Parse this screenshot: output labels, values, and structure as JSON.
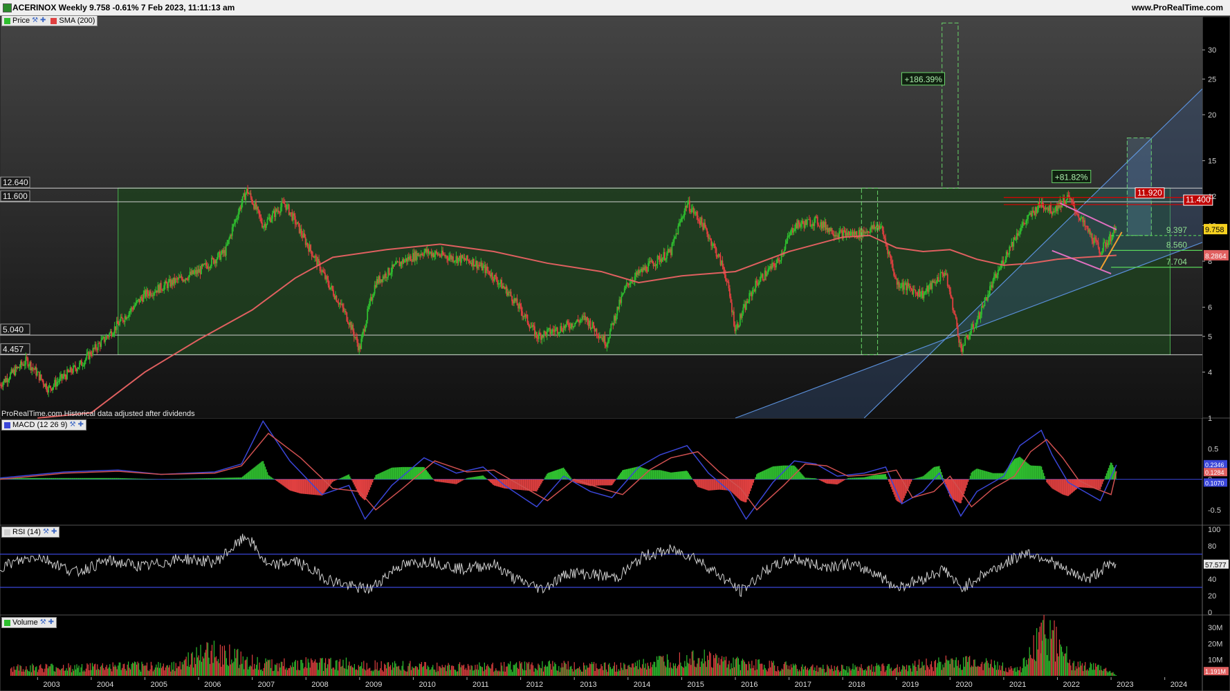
{
  "header": {
    "title": "ACERINOX Weekly 9.758 -0.61% 7 Feb 2023, 11:11:13 am",
    "source_url": "www.ProRealTime.com"
  },
  "legend": {
    "price": "Price",
    "sma": "SMA (200)",
    "macd": "MACD (12 26 9)",
    "rsi": "RSI (14)",
    "volume": "Volume"
  },
  "watermark": "ProRealTime.com  Historical data adjusted after dividends",
  "colors": {
    "background": "#000000",
    "candle_up": "#2fbf2f",
    "candle_down": "#e04040",
    "sma": "#e06060",
    "box_fill": "#1e3f1e",
    "box_stroke": "#4caf50",
    "channel": "#5a8fd8",
    "macd": "#3a46d8",
    "signal": "#d05050",
    "rsi": "#cfcfcf",
    "rsi_bands": "#3a46d8",
    "resistance": "#e00000",
    "pennant": "#e070c0",
    "breakout": "#f0a030"
  },
  "chart_data": [
    {
      "type": "candlestick",
      "name": "price",
      "ylim": [
        3,
        36
      ],
      "scale": "log",
      "x_range": [
        "2002.3",
        "2024.7"
      ],
      "x_ticks": [
        "2003",
        "2004",
        "2005",
        "2006",
        "2007",
        "2008",
        "2009",
        "2010",
        "2011",
        "2012",
        "2013",
        "2014",
        "2015",
        "2016",
        "2017",
        "2018",
        "2019",
        "2020",
        "2021",
        "2022",
        "2023",
        "2024"
      ],
      "y_ticks": [
        "30",
        "25",
        "20",
        "15",
        "12",
        "10",
        "8",
        "6",
        "5",
        "4"
      ],
      "series": [
        {
          "name": "Price",
          "x": [
            2002.3,
            2002.8,
            2003.2,
            2003.8,
            2004.3,
            2004.6,
            2005.0,
            2005.5,
            2006.0,
            2006.5,
            2006.9,
            2007.2,
            2007.6,
            2008.0,
            2008.4,
            2008.8,
            2009.0,
            2009.3,
            2009.8,
            2010.2,
            2010.7,
            2011.1,
            2011.4,
            2011.8,
            2012.3,
            2012.8,
            2013.2,
            2013.6,
            2014.0,
            2014.4,
            2014.8,
            2015.1,
            2015.4,
            2015.8,
            2016.0,
            2016.4,
            2016.8,
            2017.1,
            2017.5,
            2017.9,
            2018.3,
            2018.7,
            2019.0,
            2019.5,
            2019.9,
            2020.2,
            2020.5,
            2020.9,
            2021.3,
            2021.7,
            2021.9,
            2022.2,
            2022.5,
            2022.8,
            2023.1
          ],
          "values": [
            3.7,
            4.3,
            3.6,
            4.2,
            5.0,
            5.6,
            6.5,
            7.0,
            7.5,
            8.5,
            12.5,
            10.0,
            11.5,
            9.0,
            7.0,
            5.5,
            4.6,
            7.0,
            8.0,
            8.5,
            8.2,
            8.0,
            7.5,
            6.5,
            5.0,
            5.3,
            5.6,
            4.8,
            7.0,
            7.8,
            8.5,
            11.5,
            10.0,
            7.5,
            5.2,
            7.0,
            8.0,
            10.0,
            10.3,
            9.5,
            9.5,
            10.0,
            7.0,
            6.5,
            7.5,
            4.6,
            5.5,
            7.5,
            9.8,
            11.5,
            11.0,
            11.9,
            10.0,
            8.5,
            9.758
          ]
        },
        {
          "name": "SMA (200)",
          "x": [
            2003.0,
            2004.0,
            2005.0,
            2006.0,
            2007.0,
            2007.8,
            2008.5,
            2009.5,
            2010.5,
            2011.5,
            2012.5,
            2013.5,
            2014.2,
            2015.0,
            2016.0,
            2017.0,
            2018.0,
            2018.5,
            2019.0,
            2019.5,
            2020.0,
            2020.5,
            2021.0,
            2021.5,
            2022.0,
            2022.5,
            2023.1
          ],
          "values": [
            3.0,
            3.1,
            4.0,
            4.9,
            5.9,
            7.2,
            8.2,
            8.6,
            8.9,
            8.5,
            7.9,
            7.5,
            7.0,
            7.3,
            7.5,
            8.5,
            9.3,
            9.4,
            8.7,
            8.5,
            8.6,
            8.1,
            7.8,
            7.9,
            8.1,
            8.2,
            8.3
          ]
        }
      ],
      "levels": [
        {
          "label": "12.640",
          "value": 12.64
        },
        {
          "label": "11.600",
          "value": 11.6
        },
        {
          "label": "5.040",
          "value": 5.04
        },
        {
          "label": "4.457",
          "value": 4.457
        }
      ],
      "right_levels": [
        {
          "label": "11.920",
          "value": 11.92,
          "color": "#e00000"
        },
        {
          "label": "11.400",
          "value": 11.4,
          "color": "#e00000"
        },
        {
          "label": "9.397",
          "value": 9.397,
          "color": "#5ad65a"
        },
        {
          "label": "8.560",
          "value": 8.56,
          "color": "#5ad65a"
        },
        {
          "label": "7.704",
          "value": 7.704,
          "color": "#5ad65a"
        }
      ],
      "badges": {
        "last_price": "9.758",
        "sma_value": "8.2864"
      },
      "annotations": [
        "+186.39%",
        "+81.82%"
      ]
    },
    {
      "type": "line",
      "name": "MACD (12 26 9)",
      "ylim": [
        -0.75,
        1.0
      ],
      "y_ticks": [
        "1",
        "0.5",
        "0",
        "-0.5"
      ],
      "badges": [
        "0.2346",
        "0.1284",
        "0.1070"
      ],
      "series": [
        {
          "name": "MACD",
          "x": [
            2002.3,
            2003.5,
            2004.5,
            2005.3,
            2006.3,
            2006.8,
            2007.2,
            2007.7,
            2008.3,
            2008.8,
            2009.1,
            2009.6,
            2010.2,
            2010.8,
            2011.3,
            2011.7,
            2012.3,
            2012.8,
            2013.3,
            2013.7,
            2014.2,
            2014.6,
            2015.1,
            2015.5,
            2015.9,
            2016.2,
            2016.7,
            2017.1,
            2017.5,
            2017.9,
            2018.4,
            2018.8,
            2019.1,
            2019.5,
            2019.8,
            2020.2,
            2020.5,
            2021.0,
            2021.3,
            2021.7,
            2021.9,
            2022.2,
            2022.5,
            2022.8,
            2023.1
          ],
          "values": [
            0.02,
            0.12,
            0.15,
            0.08,
            0.12,
            0.25,
            0.95,
            0.3,
            -0.25,
            -0.1,
            -0.65,
            -0.1,
            0.35,
            0.1,
            0.2,
            -0.1,
            -0.45,
            0.05,
            -0.2,
            -0.3,
            0.2,
            0.4,
            0.55,
            0.1,
            -0.2,
            -0.65,
            -0.05,
            0.3,
            0.25,
            0.05,
            0.1,
            0.2,
            -0.4,
            -0.2,
            0.1,
            -0.6,
            -0.2,
            0.05,
            0.55,
            0.8,
            0.4,
            -0.05,
            -0.2,
            -0.35,
            0.2346
          ]
        },
        {
          "name": "Signal",
          "x": [
            2002.3,
            2003.5,
            2004.5,
            2005.3,
            2006.3,
            2006.8,
            2007.3,
            2007.9,
            2008.5,
            2009.0,
            2009.3,
            2009.8,
            2010.4,
            2011.0,
            2011.5,
            2011.9,
            2012.5,
            2013.0,
            2013.5,
            2013.9,
            2014.4,
            2014.8,
            2015.3,
            2015.7,
            2016.1,
            2016.4,
            2016.9,
            2017.3,
            2017.7,
            2018.1,
            2018.6,
            2019.0,
            2019.3,
            2019.7,
            2020.0,
            2020.4,
            2020.8,
            2021.2,
            2021.5,
            2021.8,
            2022.1,
            2022.4,
            2022.7,
            2023.0,
            2023.1
          ],
          "values": [
            0.0,
            0.1,
            0.13,
            0.08,
            0.1,
            0.22,
            0.75,
            0.35,
            -0.15,
            -0.2,
            -0.5,
            -0.15,
            0.3,
            0.12,
            0.15,
            -0.05,
            -0.35,
            0.0,
            -0.15,
            -0.25,
            0.15,
            0.35,
            0.45,
            0.12,
            -0.15,
            -0.5,
            -0.1,
            0.25,
            0.22,
            0.05,
            0.08,
            0.15,
            -0.3,
            -0.2,
            0.05,
            -0.45,
            -0.15,
            0.05,
            0.45,
            0.65,
            0.35,
            -0.02,
            -0.15,
            -0.25,
            0.1284
          ]
        }
      ]
    },
    {
      "type": "line",
      "name": "RSI (14)",
      "ylim": [
        0,
        100
      ],
      "y_ticks": [
        "100",
        "80",
        "60",
        "40",
        "20",
        "0"
      ],
      "bands": [
        70,
        30
      ],
      "badges": [
        "57.577"
      ],
      "series": [
        {
          "name": "RSI",
          "x": [
            2002.3,
            2003.0,
            2003.7,
            2004.3,
            2005.0,
            2005.7,
            2006.3,
            2006.9,
            2007.3,
            2007.8,
            2008.4,
            2008.9,
            2009.2,
            2009.7,
            2010.3,
            2010.9,
            2011.5,
            2011.9,
            2012.4,
            2012.9,
            2013.4,
            2013.8,
            2014.3,
            2014.8,
            2015.2,
            2015.7,
            2016.1,
            2016.6,
            2017.1,
            2017.6,
            2018.1,
            2018.6,
            2019.0,
            2019.4,
            2019.9,
            2020.2,
            2020.6,
            2021.0,
            2021.4,
            2021.8,
            2022.2,
            2022.6,
            2022.9,
            2023.1
          ],
          "values": [
            55,
            68,
            48,
            62,
            55,
            65,
            60,
            92,
            55,
            62,
            40,
            30,
            28,
            55,
            62,
            52,
            58,
            40,
            28,
            48,
            45,
            42,
            68,
            75,
            68,
            45,
            25,
            52,
            65,
            55,
            58,
            48,
            30,
            38,
            52,
            28,
            45,
            58,
            72,
            65,
            48,
            40,
            55,
            57.577
          ]
        }
      ]
    },
    {
      "type": "bar",
      "name": "Volume",
      "ylim": [
        0,
        36000000
      ],
      "y_ticks": [
        "30M",
        "20M",
        "10M"
      ],
      "badges": [
        "1.191M"
      ],
      "series": [
        {
          "name": "Volume",
          "x": [
            2002.5,
            2004.0,
            2005.5,
            2006.3,
            2007.2,
            2008.5,
            2009.5,
            2011.0,
            2012.5,
            2014.0,
            2015.2,
            2016.0,
            2017.5,
            2019.0,
            2020.3,
            2021.3,
            2021.7,
            2022.0,
            2022.3,
            2022.8,
            2023.1
          ],
          "values": [
            6000000,
            7000000,
            8000000,
            20000000,
            9000000,
            10000000,
            8000000,
            7000000,
            8000000,
            7000000,
            15000000,
            10000000,
            6000000,
            7000000,
            12000000,
            5000000,
            33000000,
            28000000,
            9000000,
            6000000,
            1191000
          ]
        }
      ]
    }
  ]
}
